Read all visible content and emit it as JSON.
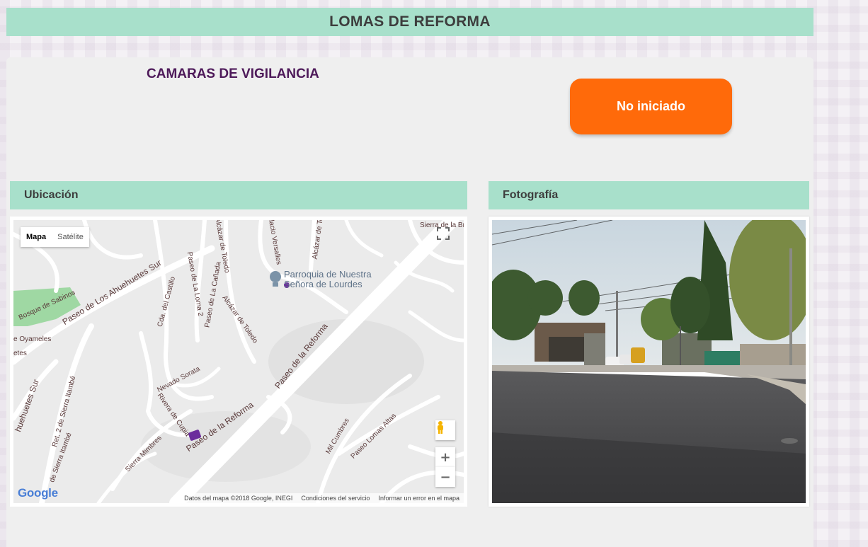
{
  "header": {
    "title": "LOMAS DE REFORMA"
  },
  "project": {
    "name": "CAMARAS DE VIGILANCIA",
    "status_label": "No iniciado",
    "status_color": "#ff6a0a"
  },
  "sections": {
    "location_title": "Ubicación",
    "photo_title": "Fotografía"
  },
  "map": {
    "type_options": [
      "Mapa",
      "Satélite"
    ],
    "selected_type": "Mapa",
    "zoom_in": "+",
    "zoom_out": "−",
    "poi": {
      "line1": "Parroquia de Nuestra",
      "line2": "Señora de Lourdes"
    },
    "street_labels": [
      "Paseo de Los Ahuehuetes Sur",
      "Bosque de Sabinos",
      "e Oyameles",
      "Cda. del Castillo",
      "Paseo de La Loma 2",
      "Paseo de La Cañada",
      "Alcázar de Toledo",
      "Alcázar de Toledo",
      "Palacio Versalles",
      "Alcázar de To",
      "Sierra de la Br",
      "Paseo de la Reforma",
      "Paseo de la Reforma",
      "Nevado Sorata",
      "Rivera de Cupia",
      "Sierra Mimbres",
      "Ret. 2 de Sierra Itambé",
      "de Sierra Itambé",
      "huehuetes Sur",
      "Mil Cumbres",
      "Paseo Lomas Altas",
      "etes"
    ],
    "logo": "Google",
    "attribution": [
      "Datos del mapa ©2018 Google, INEGI",
      "Condiciones del servicio",
      "Informar un error en el mapa"
    ],
    "colors": {
      "park": "#9fd8a3",
      "marker": "#6b2d9c",
      "road": "#ffffff",
      "base": "#ebebeb"
    }
  }
}
